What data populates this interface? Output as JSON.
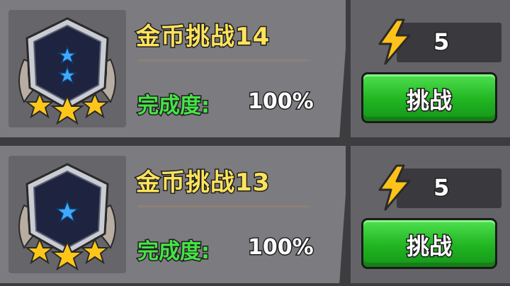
{
  "challenges": [
    {
      "title": "金币挑战14",
      "progress_label": "完成度:",
      "progress_value": "100%",
      "stars_inside": 2,
      "stars_rating": 3,
      "cost_icon": "lightning-bolt-icon",
      "cost_value": "5",
      "button_label": "挑战"
    },
    {
      "title": "金币挑战13",
      "progress_label": "完成度:",
      "progress_value": "100%",
      "stars_inside": 1,
      "stars_rating": 3,
      "cost_icon": "lightning-bolt-icon",
      "cost_value": "5",
      "button_label": "挑战"
    }
  ],
  "colors": {
    "title": "#ffe35a",
    "progress_label": "#46e346",
    "button": "#21b521",
    "bolt": "#ffc21a",
    "inner_star": "#3fa8ff",
    "rating_star": "#ffc61a"
  }
}
